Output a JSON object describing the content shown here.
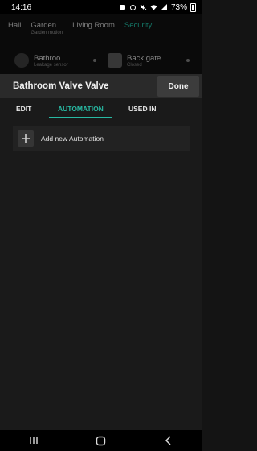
{
  "status": {
    "time": "14:16",
    "battery": "73%"
  },
  "top_tabs": [
    {
      "label": "Hall",
      "sub": ""
    },
    {
      "label": "Garden",
      "sub": "Garden motion"
    },
    {
      "label": "Living Room",
      "sub": ""
    },
    {
      "label": "Security",
      "sub": ""
    }
  ],
  "cards": [
    {
      "name": "Bathroo...",
      "state": "Leakage sensor"
    },
    {
      "name": "Back gate",
      "state": "Closed"
    }
  ],
  "sheet": {
    "title": "Bathroom Valve Valve",
    "done_label": "Done",
    "tabs": [
      "EDIT",
      "AUTOMATION",
      "USED IN"
    ],
    "add_label": "Add new Automation"
  },
  "colors": {
    "accent": "#28b9a3"
  }
}
